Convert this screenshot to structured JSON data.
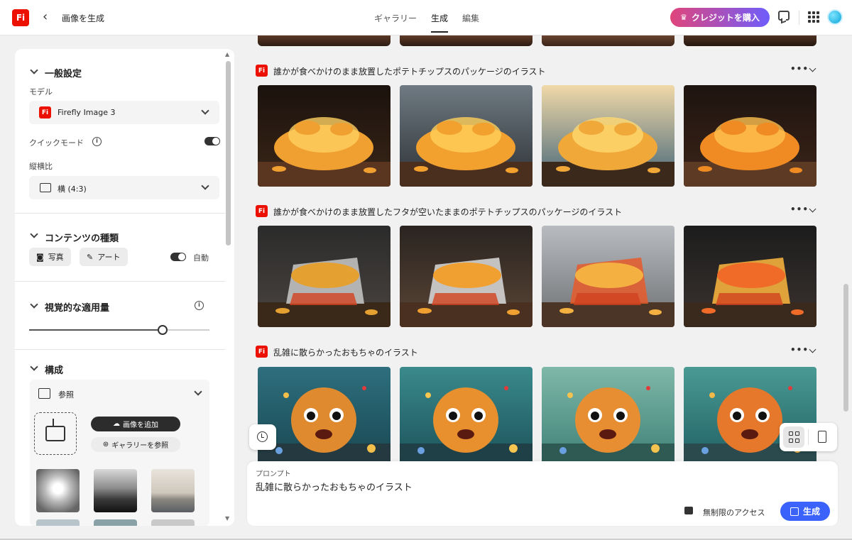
{
  "header": {
    "logo": "Fi",
    "back_icon": "chevron-left-icon",
    "page_title": "画像を生成",
    "tabs": [
      {
        "label": "ギャラリー",
        "active": false
      },
      {
        "label": "生成",
        "active": true
      },
      {
        "label": "編集",
        "active": false
      }
    ],
    "buy_credits_label": "クレジットを購入",
    "accent_gradient": [
      "#e0457b",
      "#6f5dfc"
    ]
  },
  "sidebar": {
    "general": {
      "title": "一般設定",
      "model_label": "モデル",
      "model_value": "Firefly Image 3",
      "quick_mode_label": "クイックモード",
      "quick_mode_on": true,
      "aspect_label": "縦横比",
      "aspect_value": "横 (4:3)"
    },
    "content_type": {
      "title": "コンテンツの種類",
      "photo_label": "写真",
      "art_label": "アート",
      "auto_label": "自動",
      "auto_on": true
    },
    "visual_intensity": {
      "title": "視覚的な適用量",
      "slider_value": 0.74
    },
    "composition": {
      "title": "構成",
      "reference_label": "参照",
      "add_image_label": "画像を追加",
      "browse_gallery_label": "ギャラリーを参照"
    }
  },
  "main": {
    "groups": [
      {
        "prompt": "誰かが食べかけのまま放置したポテトチップスのパッケージのイラスト",
        "kind": "chips"
      },
      {
        "prompt": "誰かが食べかけのまま放置したフタが空いたままのポテトチップスのパッケージのイラスト",
        "kind": "bag"
      },
      {
        "prompt": "乱雑に散らかったおもちゃのイラスト",
        "kind": "toys"
      }
    ]
  },
  "prompt_bar": {
    "label": "プロンプト",
    "value": "乱雑に散らかったおもちゃのイラスト",
    "unlimited_label": "無制限のアクセス",
    "generate_label": "生成",
    "generate_color": "#3b63fb"
  }
}
